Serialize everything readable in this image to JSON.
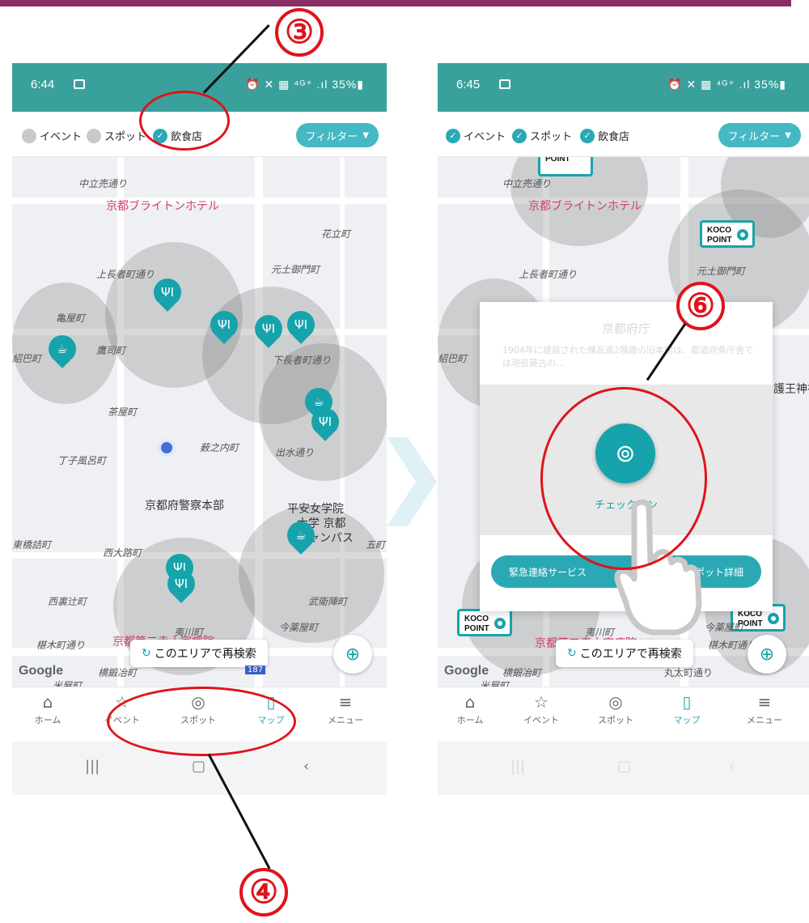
{
  "colors": {
    "teal": "#17a3ab",
    "status_bar": "#3aa09c",
    "annotation_red": "#e0131b",
    "top_bar": "#8a2f66"
  },
  "annotations": {
    "step3": "③",
    "step4": "④",
    "step6": "⑥"
  },
  "left": {
    "status": {
      "time": "6:44",
      "icons": "⏰ ✕ ▦ ⁴ᴳ⁺ .ıl 35%▮"
    },
    "filters": {
      "event": "イベント",
      "spot": "スポット",
      "restaurant": "飲食店",
      "filter_button": "フィルター"
    },
    "map_labels": {
      "nakadachiuri": "中立売通り",
      "hotel": "京都ブライトンホテル",
      "hanatate": "花立町",
      "kamichojamachi": "上長者町通り",
      "motodoshimon": "元土御門町",
      "kameya": "亀屋町",
      "takatsukasa": "鷹司町",
      "shimochoja": "下長者町通り",
      "shoha": "紹巴町",
      "chaya": "茶屋町",
      "yabunouchi": "薮之内町",
      "demizu": "出水通り",
      "chojiburo": "丁子風呂町",
      "police": "京都府警察本部",
      "heian": "平安女学院",
      "heian2": "大学 京都",
      "heian3": "キャンパス",
      "higashihashizume": "東橋詰町",
      "nishioji": "西大路町",
      "gocho": "五町",
      "nishiurazuji": "西裏辻町",
      "bueijin": "武衛陣町",
      "shiinoki": "椹木町通り",
      "hospital": "京都第二赤十字病院",
      "yoneya": "米屋町",
      "ikawa": "夷川町",
      "imayakushi": "今薬屋町",
      "kajiya": "横鍛冶町",
      "google": "Google",
      "route": "187"
    },
    "research_button": "このエリアで再検索",
    "nav": {
      "home": "ホーム",
      "event": "イベント",
      "spot": "スポット",
      "map": "マップ",
      "menu": "メニュー"
    }
  },
  "right": {
    "status": {
      "time": "6:45",
      "icons": "⏰ ✕ ▦ ⁴ᴳ⁺ .ıl 35%▮"
    },
    "filters": {
      "event": "イベント",
      "spot": "スポット",
      "restaurant": "飲食店",
      "filter_button": "フィルター"
    },
    "map_labels": {
      "nakadachiuri": "中立売通り",
      "hotel": "京都ブライトンホテル",
      "kamichojamachi": "上長者町通り",
      "motodoshimon": "元土御門町",
      "shoha": "紹巴町",
      "goou": "護王神社",
      "hospital": "京都第二赤十字病院",
      "shiinoki": "椹木町通り",
      "yoneya": "米屋町",
      "ikawa": "夷川町",
      "imayakushi": "今薬屋町",
      "kajiya": "横鍛冶町",
      "marutamachi": "丸太町通り",
      "google": "Google"
    },
    "koco_point": {
      "line1": "KOCO",
      "line2": "POINT"
    },
    "modal": {
      "title": "京都府庁",
      "description": "1904年に建設された煉瓦造2階建の旧本館は、都道府県庁舎では現役最古の…",
      "checkin_label": "チェックイン",
      "emergency_left": "緊急連絡サービス",
      "emergency_right": "スポット詳細"
    },
    "research_button": "このエリアで再検索",
    "nav": {
      "home": "ホーム",
      "event": "イベント",
      "spot": "スポット",
      "map": "マップ",
      "menu": "メニュー"
    }
  }
}
